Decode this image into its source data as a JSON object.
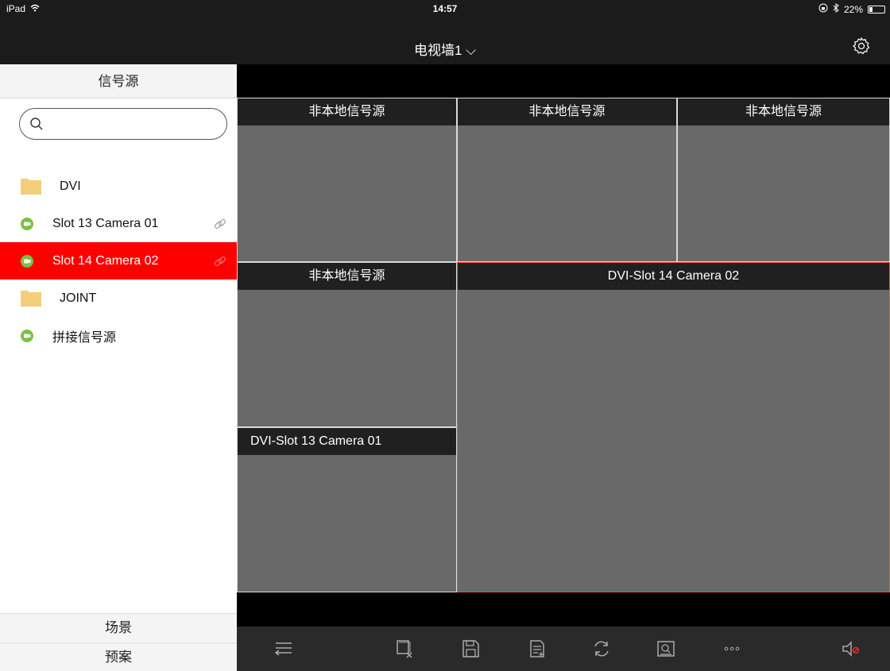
{
  "status_bar": {
    "device": "iPad",
    "time": "14:57",
    "battery_text": "22%",
    "battery_level": 0.22
  },
  "header": {
    "title": "电视墙1 ⌵",
    "settings_icon": "gear-icon"
  },
  "sidebar": {
    "header": "信号源",
    "search": {
      "placeholder": "",
      "value": ""
    },
    "items": [
      {
        "type": "folder",
        "label": "DVI",
        "icon": "folder-icon"
      },
      {
        "type": "camera",
        "label": "Slot 13 Camera 01",
        "icon": "camera-icon",
        "linked": true,
        "selected": false
      },
      {
        "type": "camera",
        "label": "Slot 14 Camera 02",
        "icon": "camera-icon",
        "linked": true,
        "selected": true
      },
      {
        "type": "folder",
        "label": "JOINT",
        "icon": "folder-icon"
      },
      {
        "type": "camera",
        "label": "拼接信号源",
        "icon": "camera-icon",
        "linked": false,
        "selected": false
      }
    ],
    "footer": {
      "scene": "场景",
      "plan": "预案"
    }
  },
  "wall": {
    "cells": [
      {
        "label": "非本地信号源"
      },
      {
        "label": "非本地信号源"
      },
      {
        "label": "非本地信号源"
      },
      {
        "label": "非本地信号源"
      },
      {
        "label": "DVI-Slot 14 Camera 02"
      },
      {
        "label": "DVI-Slot 13 Camera 01"
      }
    ]
  },
  "toolbar": {
    "icons": [
      "collapse-list-icon",
      "close-window-icon",
      "save-icon",
      "document-icon",
      "refresh-icon",
      "zoom-window-icon",
      "more-icon",
      "mute-icon"
    ]
  },
  "colors": {
    "selection": "#ff0000",
    "camera_green": "#7ac143",
    "folder_yellow": "#f3cf7a",
    "wall_cell": "#696969",
    "mute_red": "#e0302e"
  }
}
